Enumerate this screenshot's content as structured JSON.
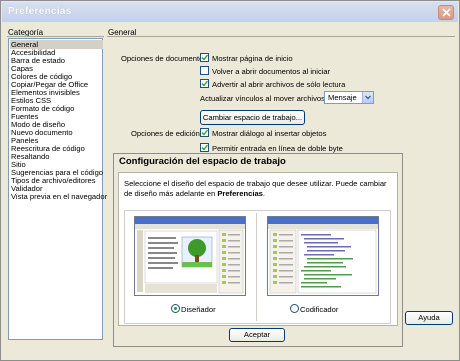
{
  "window": {
    "title": "Preferencias"
  },
  "categories": {
    "header": "Categoría",
    "selected_index": 0,
    "items": [
      "General",
      "Accesibilidad",
      "Barra de estado",
      "Capas",
      "Colores de código",
      "Copiar/Pegar de Office",
      "Elementos invisibles",
      "Estilos CSS",
      "Formato de código",
      "Fuentes",
      "Modo de diseño",
      "Nuevo documento",
      "Paneles",
      "Reescritura de código",
      "Resaltando",
      "Sitio",
      "Sugerencias para el código",
      "Tipos de archivo/editores",
      "Validador",
      "Vista previa en el navegador"
    ]
  },
  "general": {
    "header": "General",
    "doc_options_label": "Opciones de documento:",
    "show_home": {
      "label": "Mostrar página de inicio",
      "checked": true
    },
    "reopen_docs": {
      "label": "Volver a abrir documentos al iniciar",
      "checked": false
    },
    "warn_readonly": {
      "label": "Advertir al abrir archivos de sólo lectura",
      "checked": true
    },
    "update_links_label": "Actualizar vínculos al mover archivos:",
    "update_links_value": "Mensaje",
    "change_workspace_button": "Cambiar espacio de trabajo...",
    "edit_options_label": "Opciones de edición:",
    "show_insert_dialog": {
      "label": "Mostrar diálogo al insertar objetos",
      "checked": true
    },
    "inline_input": {
      "label": "Permitir entrada en línea de doble byte",
      "checked": true
    }
  },
  "help_button": "Ayuda",
  "workspace_dialog": {
    "title": "Configuración del espacio de trabajo",
    "description_prefix": "Seleccione el diseño del espacio de trabajo que desee utilizar. Puede cambiar de diseño más adelante en ",
    "description_bold": "Preferencias",
    "description_suffix": ".",
    "options": [
      {
        "label": "Diseñador",
        "selected": true
      },
      {
        "label": "Codificador",
        "selected": false
      }
    ],
    "accept_button": "Aceptar"
  },
  "colors": {
    "accent": "#003c74",
    "selection": "#d4d0c8",
    "dialog_bg": "#ece9d8"
  }
}
